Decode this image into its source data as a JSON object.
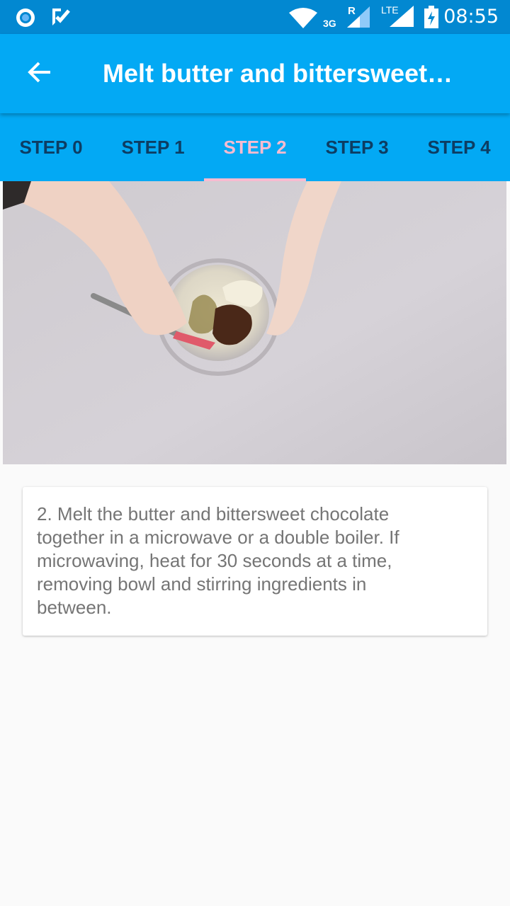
{
  "status_bar": {
    "time": "08:55",
    "network_label": "3G",
    "roaming_label": "R",
    "lte_label": "LTE",
    "icons": [
      "record-icon",
      "checklist-icon",
      "wifi-icon",
      "signal-icon",
      "lte-signal-icon",
      "battery-charging-icon"
    ]
  },
  "appbar": {
    "title": "Melt butter and bittersweet…",
    "back_icon": "arrow-back-icon"
  },
  "tabs": [
    {
      "label": "STEP 0"
    },
    {
      "label": "STEP 1"
    },
    {
      "label": "STEP 2",
      "selected": true
    },
    {
      "label": "STEP 3"
    },
    {
      "label": "STEP 4"
    }
  ],
  "step": {
    "description": "2. Melt the butter and bittersweet chocolate together in a microwave or a double boiler. If microwaving, heat for 30 seconds at a time, removing bowl and stirring ingredients in between."
  },
  "colors": {
    "status_bar": "#0288d1",
    "primary": "#03a9f4",
    "tab_text": "#0d3d63",
    "tab_selected": "#f8bbd0",
    "body_text": "#757575",
    "background": "#fafafa"
  }
}
